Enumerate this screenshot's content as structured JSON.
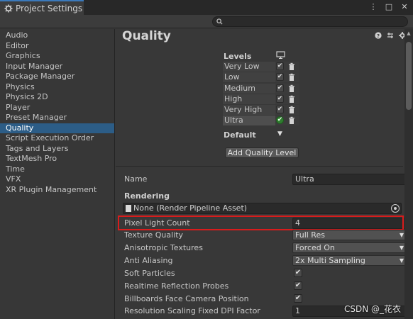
{
  "window": {
    "tab_title": "Project Settings",
    "controls": [
      "⋮",
      "□",
      "✕"
    ]
  },
  "search": {
    "value": "",
    "placeholder": ""
  },
  "sidebar": {
    "items": [
      {
        "label": "Audio",
        "active": false
      },
      {
        "label": "Editor",
        "active": false
      },
      {
        "label": "Graphics",
        "active": false
      },
      {
        "label": "Input Manager",
        "active": false
      },
      {
        "label": "Package Manager",
        "active": false
      },
      {
        "label": "Physics",
        "active": false
      },
      {
        "label": "Physics 2D",
        "active": false
      },
      {
        "label": "Player",
        "active": false
      },
      {
        "label": "Preset Manager",
        "active": false
      },
      {
        "label": "Quality",
        "active": true
      },
      {
        "label": "Script Execution Order",
        "active": false
      },
      {
        "label": "Tags and Layers",
        "active": false
      },
      {
        "label": "TextMesh Pro",
        "active": false
      },
      {
        "label": "Time",
        "active": false
      },
      {
        "label": "VFX",
        "active": false
      },
      {
        "label": "XR Plugin Management",
        "active": false
      }
    ]
  },
  "main": {
    "title": "Quality",
    "header_icons": [
      "help-icon",
      "preset-icon",
      "settings-gear-icon"
    ],
    "levels": {
      "label": "Levels",
      "items": [
        {
          "label": "Very Low",
          "checked": true,
          "default": false
        },
        {
          "label": "Low",
          "checked": true,
          "default": false
        },
        {
          "label": "Medium",
          "checked": true,
          "default": false
        },
        {
          "label": "High",
          "checked": true,
          "default": false
        },
        {
          "label": "Very High",
          "checked": true,
          "default": false
        },
        {
          "label": "Ultra",
          "checked": true,
          "default": true
        }
      ],
      "default_label": "Default",
      "add_button": "Add Quality Level"
    },
    "name": {
      "label": "Name",
      "value": "Ultra"
    },
    "rendering": {
      "header": "Rendering",
      "render_pipeline_asset": "None (Render Pipeline Asset)",
      "settings": [
        {
          "label": "Pixel Light Count",
          "kind": "field",
          "value": "4"
        },
        {
          "label": "Texture Quality",
          "kind": "dropdown",
          "value": "Full Res"
        },
        {
          "label": "Anisotropic Textures",
          "kind": "dropdown",
          "value": "Forced On"
        },
        {
          "label": "Anti Aliasing",
          "kind": "dropdown",
          "value": "2x Multi Sampling"
        },
        {
          "label": "Soft Particles",
          "kind": "checkbox",
          "value": true
        },
        {
          "label": "Realtime Reflection Probes",
          "kind": "checkbox",
          "value": true
        },
        {
          "label": "Billboards Face Camera Position",
          "kind": "checkbox",
          "value": true
        },
        {
          "label": "Resolution Scaling Fixed DPI Factor",
          "kind": "field",
          "value": "1"
        }
      ]
    }
  },
  "watermark": "CSDN @_花衣",
  "colors": {
    "accent_selection": "#2c5d87",
    "highlight_box": "#d91c1c",
    "default_level": "#2f7c2f"
  }
}
